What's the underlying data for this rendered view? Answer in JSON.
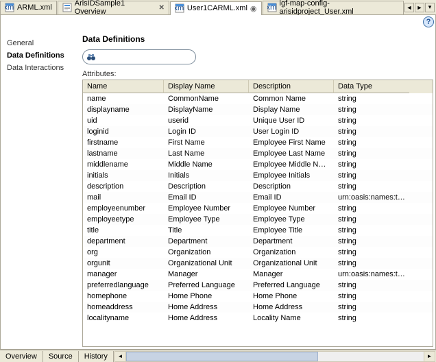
{
  "tabs": [
    {
      "label": "ARML.xml",
      "type": "xml"
    },
    {
      "label": "ArisIDSample1 Overview",
      "type": "form",
      "closable": true
    },
    {
      "label": "User1CARML.xml",
      "type": "xml",
      "active": true,
      "pinned": true
    },
    {
      "label": "igf-map-config-arisidproject_User.xml",
      "type": "xml"
    }
  ],
  "sidebar": {
    "items": [
      {
        "label": "General"
      },
      {
        "label": "Data Definitions",
        "selected": true
      },
      {
        "label": "Data Interactions"
      }
    ]
  },
  "main": {
    "title": "Data Definitions",
    "search_value": "",
    "attributes_label": "Attributes:"
  },
  "columns": [
    "Name",
    "Display Name",
    "Description",
    "Data Type"
  ],
  "rows": [
    [
      "name",
      "CommonName",
      "Common Name",
      "string"
    ],
    [
      "displayname",
      "DisplayName",
      "Display Name",
      "string"
    ],
    [
      "uid",
      "userid",
      "Unique User ID",
      "string"
    ],
    [
      "loginid",
      "Login ID",
      "User Login ID",
      "string"
    ],
    [
      "firstname",
      "First Name",
      "Employee First Name",
      "string"
    ],
    [
      "lastname",
      "Last Name",
      "Employee Last Name",
      "string"
    ],
    [
      "middlename",
      "Middle Name",
      "Employee Middle Name",
      "string"
    ],
    [
      "initials",
      "Initials",
      "Employee Initials",
      "string"
    ],
    [
      "description",
      "Description",
      "Description",
      "string"
    ],
    [
      "mail",
      "Email ID",
      "Email ID",
      "urn:oasis:names:tc:xa.."
    ],
    [
      "employeenumber",
      "Employee Number",
      "Employee Number",
      "string"
    ],
    [
      "employeetype",
      "Employee Type",
      "Employee Type",
      "string"
    ],
    [
      "title",
      "Title",
      "Employee Title",
      "string"
    ],
    [
      "department",
      "Department",
      "Department",
      "string"
    ],
    [
      "org",
      "Organization",
      "Organization",
      "string"
    ],
    [
      "orgunit",
      "Organizational Unit",
      "Organizational Unit",
      "string"
    ],
    [
      "manager",
      "Manager",
      "Manager",
      "urn:oasis:names:tc:xa.."
    ],
    [
      "preferredlanguage",
      "Preferred Language",
      "Preferred Language",
      "string"
    ],
    [
      "homephone",
      "Home Phone",
      "Home Phone",
      "string"
    ],
    [
      "homeaddress",
      "Home Address",
      "Home Address",
      "string"
    ],
    [
      "localityname",
      "Home Address",
      "Locality Name",
      "string"
    ]
  ],
  "bottom_tabs": [
    "Overview",
    "Source",
    "History"
  ]
}
